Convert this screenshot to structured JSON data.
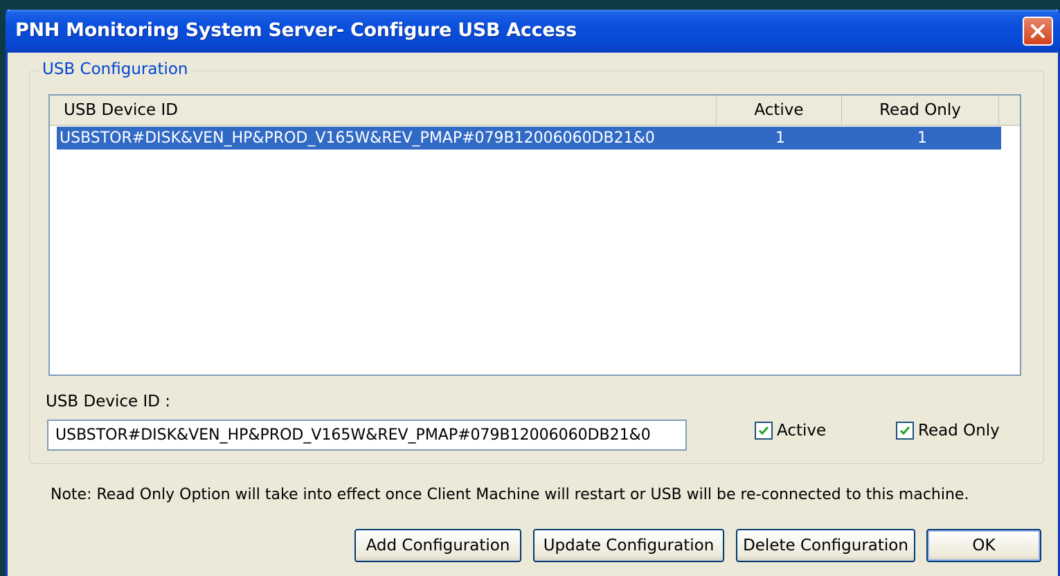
{
  "window": {
    "title": "PNH Monitoring System Server- Configure USB Access",
    "title_bar_color": "#0a4fdc",
    "background_color": "#ece9d8"
  },
  "group": {
    "label": "USB Configuration"
  },
  "table": {
    "columns": [
      "USB Device ID",
      "Active",
      "Read Only"
    ],
    "rows": [
      {
        "device_id": "USBSTOR#DISK&VEN_HP&PROD_V165W&REV_PMAP#079B12006060DB21&0",
        "active": "1",
        "read_only": "1",
        "selected": true
      }
    ],
    "selection_color": "#316ac5"
  },
  "form": {
    "device_id_label": "USB Device ID :",
    "device_id_value": "USBSTOR#DISK&VEN_HP&PROD_V165W&REV_PMAP#079B12006060DB21&0",
    "active_label": "Active",
    "active_checked": true,
    "read_only_label": "Read Only",
    "read_only_checked": true
  },
  "note": "Note: Read Only Option will take into effect once Client Machine will restart or USB will be re-connected to this machine.",
  "buttons": {
    "add": "Add Configuration",
    "update": "Update Configuration",
    "delete": "Delete Configuration",
    "ok": "OK"
  },
  "icons": {
    "close": "close-icon",
    "check": "checkmark-icon"
  }
}
